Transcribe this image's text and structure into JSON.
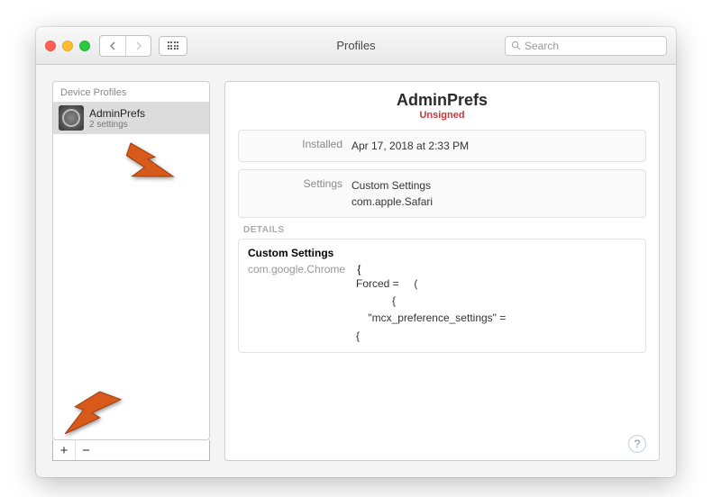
{
  "window": {
    "title": "Profiles",
    "search_placeholder": "Search"
  },
  "sidebar": {
    "section_label": "Device Profiles",
    "items": [
      {
        "name": "AdminPrefs",
        "sub": "2 settings"
      }
    ],
    "plus_label": "+",
    "minus_label": "−"
  },
  "detail": {
    "title": "AdminPrefs",
    "status": "Unsigned",
    "installed_label": "Installed",
    "installed_value": "Apr 17, 2018 at 2:33 PM",
    "settings_label": "Settings",
    "settings_value_1": "Custom Settings",
    "settings_value_2": "com.apple.Safari",
    "details_header": "DETAILS",
    "custom_settings_label": "Custom Settings",
    "domain": "com.google.Chrome",
    "code_line_open": "{",
    "code_line_1": "Forced =     (",
    "code_line_2": "            {",
    "code_line_3": "    \"mcx_preference_settings\" =",
    "code_line_4": "{",
    "help_label": "?"
  }
}
